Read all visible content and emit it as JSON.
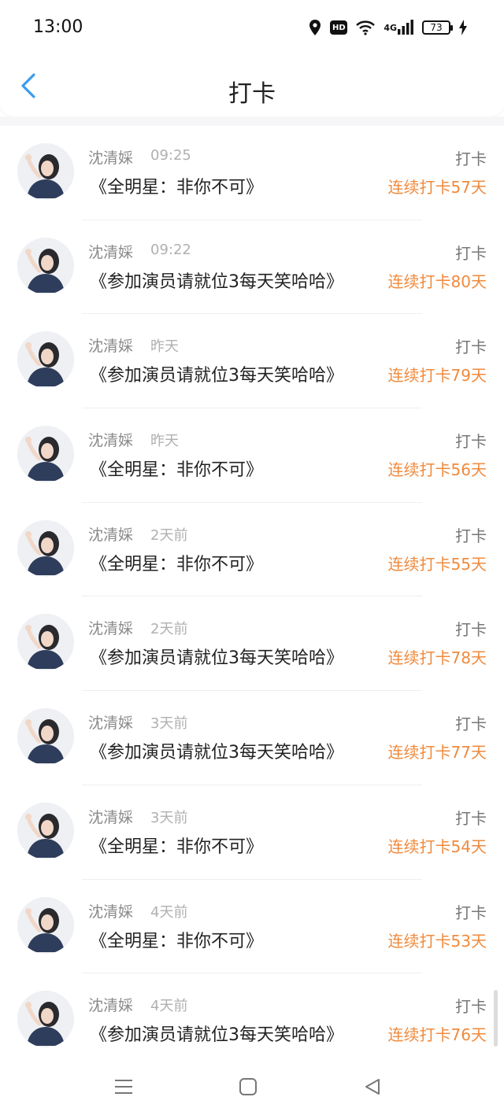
{
  "status_bar": {
    "time": "13:00",
    "hd_label": "HD",
    "network_label": "4G",
    "battery": "73"
  },
  "header": {
    "title": "打卡",
    "back_icon": "chevron-left-icon"
  },
  "avatar_icon": "user-avatar",
  "colors": {
    "back_blue": "#3b9cf0",
    "streak_orange": "#f08a3c"
  },
  "checkins": [
    {
      "name": "沈清婇",
      "time": "09:25",
      "title": "《全明星：非你不可》",
      "action": "打卡",
      "streak": "连续打卡57天"
    },
    {
      "name": "沈清婇",
      "time": "09:22",
      "title": "《参加演员请就位3每天笑哈哈》",
      "action": "打卡",
      "streak": "连续打卡80天"
    },
    {
      "name": "沈清婇",
      "time": "昨天",
      "title": "《参加演员请就位3每天笑哈哈》",
      "action": "打卡",
      "streak": "连续打卡79天"
    },
    {
      "name": "沈清婇",
      "time": "昨天",
      "title": "《全明星：非你不可》",
      "action": "打卡",
      "streak": "连续打卡56天"
    },
    {
      "name": "沈清婇",
      "time": "2天前",
      "title": "《全明星：非你不可》",
      "action": "打卡",
      "streak": "连续打卡55天"
    },
    {
      "name": "沈清婇",
      "time": "2天前",
      "title": "《参加演员请就位3每天笑哈哈》",
      "action": "打卡",
      "streak": "连续打卡78天"
    },
    {
      "name": "沈清婇",
      "time": "3天前",
      "title": "《参加演员请就位3每天笑哈哈》",
      "action": "打卡",
      "streak": "连续打卡77天"
    },
    {
      "name": "沈清婇",
      "time": "3天前",
      "title": "《全明星：非你不可》",
      "action": "打卡",
      "streak": "连续打卡54天"
    },
    {
      "name": "沈清婇",
      "time": "4天前",
      "title": "《全明星：非你不可》",
      "action": "打卡",
      "streak": "连续打卡53天"
    },
    {
      "name": "沈清婇",
      "time": "4天前",
      "title": "《参加演员请就位3每天笑哈哈》",
      "action": "打卡",
      "streak": "连续打卡76天"
    }
  ],
  "nav_bar": {
    "menu_icon": "menu-icon",
    "home_icon": "home-square-icon",
    "back_icon": "back-triangle-icon"
  }
}
